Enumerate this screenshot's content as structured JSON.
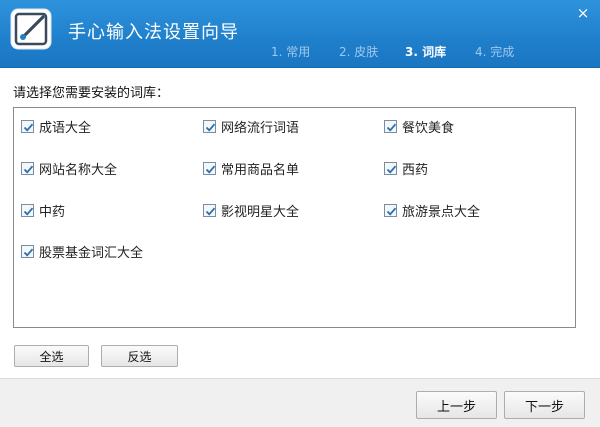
{
  "window": {
    "title": "手心输入法设置向导",
    "close_glyph": "×"
  },
  "steps": [
    {
      "label": "1. 常用",
      "active": false
    },
    {
      "label": "2. 皮肤",
      "active": false
    },
    {
      "label": "3. 词库",
      "active": true
    },
    {
      "label": "4. 完成",
      "active": false
    }
  ],
  "prompt": "请选择您需要安装的词库：",
  "dictionaries": [
    {
      "label": "成语大全",
      "checked": true
    },
    {
      "label": "网络流行词语",
      "checked": true
    },
    {
      "label": "餐饮美食",
      "checked": true
    },
    {
      "label": "网站名称大全",
      "checked": true
    },
    {
      "label": "常用商品名单",
      "checked": true
    },
    {
      "label": "西药",
      "checked": true
    },
    {
      "label": "中药",
      "checked": true
    },
    {
      "label": "影视明星大全",
      "checked": true
    },
    {
      "label": "旅游景点大全",
      "checked": true
    },
    {
      "label": "股票基金词汇大全",
      "checked": true
    }
  ],
  "buttons": {
    "select_all": "全选",
    "invert": "反选",
    "prev": "上一步",
    "next": "下一步"
  },
  "colors": {
    "titlebar": "#1f7fcb",
    "check": "#2a6fb0"
  }
}
